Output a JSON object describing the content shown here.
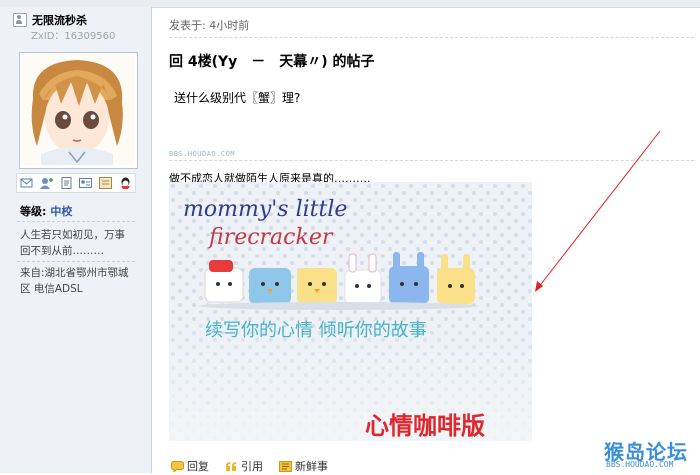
{
  "user": {
    "name": "无限流秒杀",
    "uid": "ZxID：16309560",
    "level_label": "等级:",
    "level_value": "中校",
    "signature": "人生若只如初见，万事回不到从前………",
    "location": "来自:湖北省鄂州市鄂城区 电信ADSL"
  },
  "post": {
    "posted": "发表于: 4小时前",
    "title": "回 4楼(Yy　－　天幕〃) 的帖子",
    "body": "送什么级别代〖蟹〗理?",
    "quote_watermark": "BBS.HOUDAO.COM",
    "caption": "做不成恋人就做陌生人原来是真的……….",
    "image": {
      "line1": "mommy's little",
      "line2": "firecracker",
      "slogan": "续写你的心情  倾听你的故事",
      "corner": "心情咖啡版"
    }
  },
  "actions": {
    "reply": "回复",
    "quote": "引用",
    "news": "新鲜事"
  },
  "logo": {
    "name": "猴岛论坛",
    "url": "BBS.HOUDAO.COM"
  },
  "colors": {
    "sidebar_bg": "#eef1f5",
    "level_color": "#2b5aa6",
    "arrow_color": "#e02020",
    "logo_color": "#3b8fd6"
  }
}
